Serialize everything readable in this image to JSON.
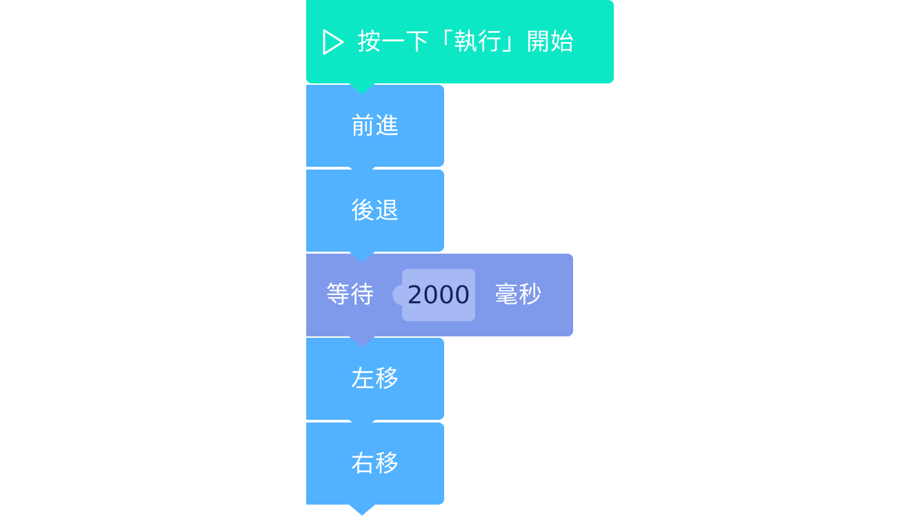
{
  "program": {
    "start_block": {
      "label": "按一下「執行」開始",
      "icon": "play-icon",
      "color": "#0ce8c5"
    },
    "blocks": [
      {
        "label": "前進",
        "color": "#52b2ff"
      },
      {
        "label": "後退",
        "color": "#52b2ff"
      },
      {
        "label": "等待",
        "value": "2000",
        "unit": "毫秒",
        "color": "#7f9aeb"
      },
      {
        "label": "左移",
        "color": "#52b2ff"
      },
      {
        "label": "右移",
        "color": "#52b2ff"
      }
    ]
  }
}
